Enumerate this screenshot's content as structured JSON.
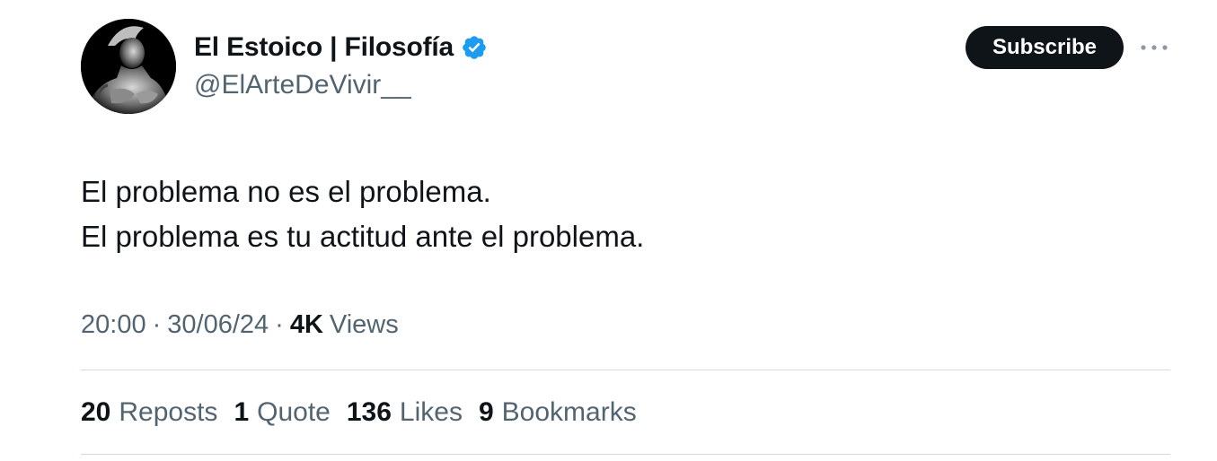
{
  "author": {
    "display_name": "El Estoico | Filosofía",
    "handle": "@ElArteDeVivir__",
    "verified": true,
    "verified_color": "#1d9bf0",
    "avatar_icon": "stoic-statue-avatar"
  },
  "actions": {
    "subscribe_label": "Subscribe",
    "more_icon": "more-horizontal-icon"
  },
  "tweet": {
    "lines": [
      "El problema no es el problema.",
      "El problema es tu actitud ante el problema."
    ]
  },
  "meta": {
    "time": "20:00",
    "separator": "·",
    "date": "30/06/24",
    "views_count": "4K",
    "views_label": "Views"
  },
  "stats": [
    {
      "count": "20",
      "label": "Reposts"
    },
    {
      "count": "1",
      "label": "Quote"
    },
    {
      "count": "136",
      "label": "Likes"
    },
    {
      "count": "9",
      "label": "Bookmarks"
    }
  ],
  "colors": {
    "text_primary": "#0f1419",
    "text_secondary": "#536471",
    "divider": "#cfd9de",
    "button_bg": "#0f1419"
  }
}
